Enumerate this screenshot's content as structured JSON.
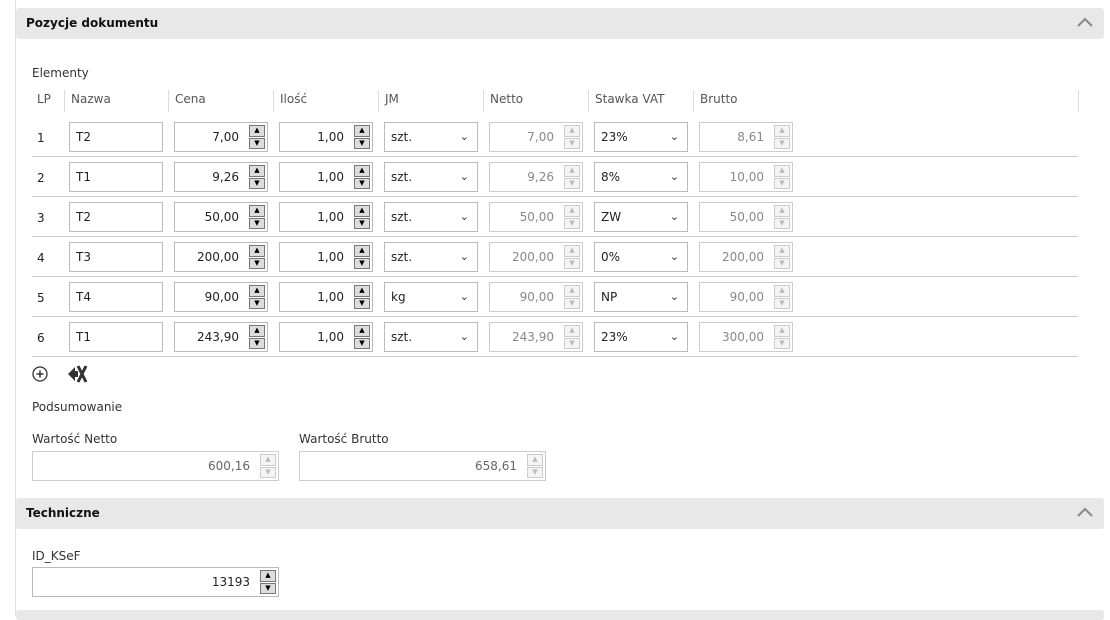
{
  "section1": {
    "title": "Pozycje dokumentu"
  },
  "elements_label": "Elementy",
  "columns": [
    "LP",
    "Nazwa",
    "Cena",
    "Ilość",
    "JM",
    "Netto",
    "Stawka VAT",
    "Brutto"
  ],
  "rows": [
    {
      "lp": "1",
      "nazwa": "T2",
      "cena": "7,00",
      "ilosc": "1,00",
      "jm": "szt.",
      "netto": "7,00",
      "vat": "23%",
      "brutto": "8,61"
    },
    {
      "lp": "2",
      "nazwa": "T1",
      "cena": "9,26",
      "ilosc": "1,00",
      "jm": "szt.",
      "netto": "9,26",
      "vat": "8%",
      "brutto": "10,00"
    },
    {
      "lp": "3",
      "nazwa": "T2",
      "cena": "50,00",
      "ilosc": "1,00",
      "jm": "szt.",
      "netto": "50,00",
      "vat": "ZW",
      "brutto": "50,00"
    },
    {
      "lp": "4",
      "nazwa": "T3",
      "cena": "200,00",
      "ilosc": "1,00",
      "jm": "szt.",
      "netto": "200,00",
      "vat": "0%",
      "brutto": "200,00"
    },
    {
      "lp": "5",
      "nazwa": "T4",
      "cena": "90,00",
      "ilosc": "1,00",
      "jm": "kg",
      "netto": "90,00",
      "vat": "NP",
      "brutto": "90,00"
    },
    {
      "lp": "6",
      "nazwa": "T1",
      "cena": "243,90",
      "ilosc": "1,00",
      "jm": "szt.",
      "netto": "243,90",
      "vat": "23%",
      "brutto": "300,00"
    }
  ],
  "summary": {
    "title": "Podsumowanie",
    "netto_label": "Wartość Netto",
    "netto": "600,16",
    "brutto_label": "Wartość Brutto",
    "brutto": "658,61"
  },
  "section2": {
    "title": "Techniczne"
  },
  "ksef": {
    "label": "ID_KSeF",
    "value": "13193"
  }
}
